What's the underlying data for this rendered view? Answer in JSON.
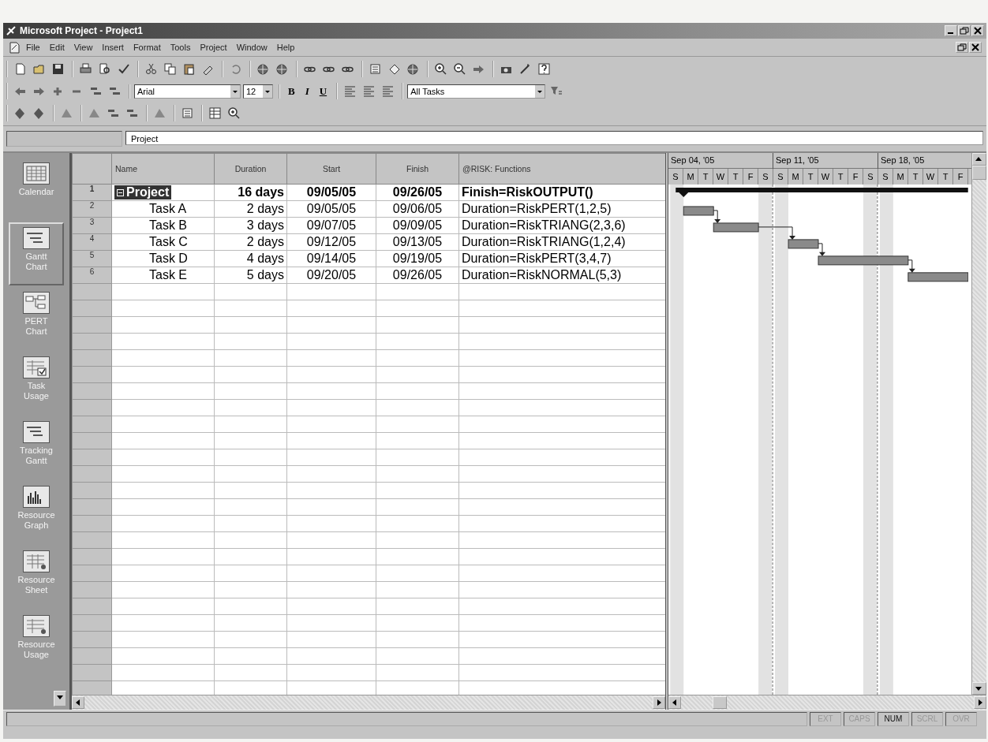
{
  "window": {
    "title": "Microsoft Project - Project1"
  },
  "menu": [
    "File",
    "Edit",
    "View",
    "Insert",
    "Format",
    "Tools",
    "Project",
    "Window",
    "Help"
  ],
  "formatting": {
    "font": "Arial",
    "size": "12",
    "bold": "B",
    "italic": "I",
    "underline": "U",
    "filter": "All Tasks"
  },
  "entry_bar": {
    "value": "Project"
  },
  "view_bar": [
    {
      "label": "Calendar",
      "selected": false
    },
    {
      "label": "Gantt Chart",
      "selected": true
    },
    {
      "label": "PERT Chart",
      "selected": false
    },
    {
      "label": "Task Usage",
      "selected": false
    },
    {
      "label": "Tracking Gantt",
      "selected": false
    },
    {
      "label": "Resource Graph",
      "selected": false
    },
    {
      "label": "Resource Sheet",
      "selected": false
    },
    {
      "label": "Resource Usage",
      "selected": false
    }
  ],
  "table": {
    "columns": [
      "Name",
      "Duration",
      "Start",
      "Finish",
      "@RISK: Functions"
    ],
    "rows": [
      {
        "id": "1",
        "kind": "summary",
        "expanded": true,
        "selected": true,
        "name": "Project",
        "duration": "16 days",
        "start": "09/05/05",
        "finish": "09/26/05",
        "function": "Finish=RiskOUTPUT()"
      },
      {
        "id": "2",
        "kind": "task",
        "selected": false,
        "name": "Task A",
        "duration": "2 days",
        "start": "09/05/05",
        "finish": "09/06/05",
        "function": "Duration=RiskPERT(1,2,5)"
      },
      {
        "id": "3",
        "kind": "task",
        "selected": false,
        "name": "Task B",
        "duration": "3 days",
        "start": "09/07/05",
        "finish": "09/09/05",
        "function": "Duration=RiskTRIANG(2,3,6)"
      },
      {
        "id": "4",
        "kind": "task",
        "selected": false,
        "name": "Task C",
        "duration": "2 days",
        "start": "09/12/05",
        "finish": "09/13/05",
        "function": "Duration=RiskTRIANG(1,2,4)"
      },
      {
        "id": "5",
        "kind": "task",
        "selected": false,
        "name": "Task D",
        "duration": "4 days",
        "start": "09/14/05",
        "finish": "09/19/05",
        "function": "Duration=RiskPERT(3,4,7)"
      },
      {
        "id": "6",
        "kind": "task",
        "selected": false,
        "name": "Task E",
        "duration": "5 days",
        "start": "09/20/05",
        "finish": "09/26/05",
        "function": "Duration=RiskNORMAL(5,3)"
      }
    ]
  },
  "timescale": [
    {
      "week": "Sep 04, '05",
      "days": [
        "S",
        "M",
        "T",
        "W",
        "T",
        "F",
        "S"
      ]
    },
    {
      "week": "Sep 11, '05",
      "days": [
        "S",
        "M",
        "T",
        "W",
        "T",
        "F",
        "S"
      ]
    },
    {
      "week": "Sep 18, '05",
      "days": [
        "S",
        "M",
        "T",
        "W",
        "T",
        "F"
      ]
    }
  ],
  "status_bar": [
    {
      "label": "EXT",
      "on": false
    },
    {
      "label": "CAPS",
      "on": false
    },
    {
      "label": "NUM",
      "on": true
    },
    {
      "label": "SCRL",
      "on": false
    },
    {
      "label": "OVR",
      "on": false
    }
  ]
}
